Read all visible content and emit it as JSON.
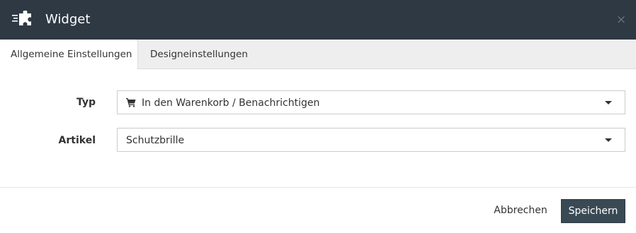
{
  "header": {
    "title": "Widget",
    "close_label": "×",
    "logo_icon": "puzzle-widget-icon",
    "background": "#2f3944"
  },
  "tabs": [
    {
      "label": "Allgemeine Einstellungen",
      "active": true
    },
    {
      "label": "Designeinstellungen",
      "active": false
    }
  ],
  "form": {
    "typ": {
      "label": "Typ",
      "value": "In den Warenkorb / Benachrichtigen",
      "icon": "shopping-cart-icon"
    },
    "artikel": {
      "label": "Artikel",
      "value": "Schutzbrille"
    }
  },
  "footer": {
    "cancel_label": "Abbrechen",
    "save_label": "Speichern",
    "save_color": "#3a4a55"
  }
}
